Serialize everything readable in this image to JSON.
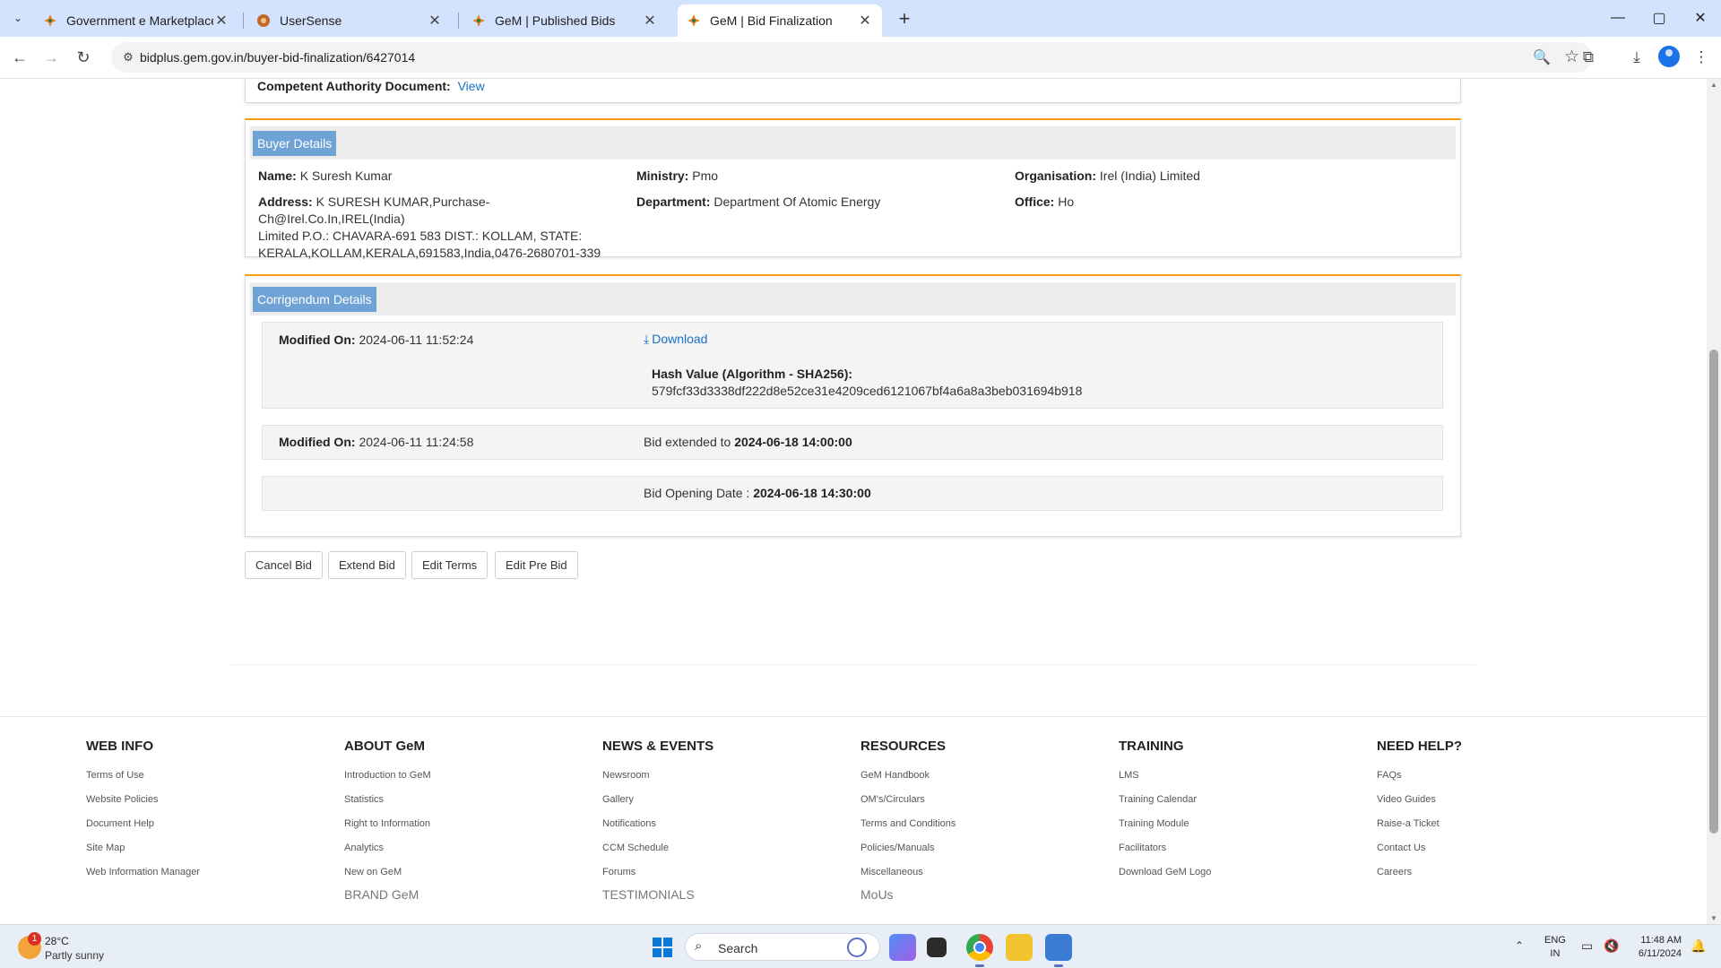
{
  "browser": {
    "tabs": [
      {
        "title": "Government e Marketplace (Ge",
        "close": "✕"
      },
      {
        "title": "UserSense",
        "close": "✕"
      },
      {
        "title": "GeM | Published Bids",
        "close": "✕"
      },
      {
        "title": "GeM | Bid Finalization",
        "close": "✕",
        "active": true
      }
    ],
    "url": "bidplus.gem.gov.in/buyer-bid-finalization/6427014",
    "window_controls": {
      "minimize": "—",
      "maximize": "▢",
      "close": "✕"
    },
    "new_tab": "+"
  },
  "page": {
    "competent_authority": {
      "label": "Competent Authority Document:",
      "link": "View"
    },
    "buyer_details": {
      "heading": "Buyer Details",
      "name_label": "Name:",
      "name": "K Suresh Kumar",
      "ministry_label": "Ministry:",
      "ministry": "Pmo",
      "organisation_label": "Organisation:",
      "organisation": "Irel (India) Limited",
      "address_label": "Address:",
      "address_line1": "K SURESH KUMAR,Purchase-Ch@Irel.Co.In,IREL(India)",
      "address_line2": "Limited P.O.: CHAVARA-691 583 DIST.: KOLLAM, STATE:",
      "address_line3": "KERALA,KOLLAM,KERALA,691583,India,0476-2680701-339",
      "department_label": "Department:",
      "department": "Department Of Atomic Energy",
      "office_label": "Office:",
      "office": "Ho"
    },
    "corrigendum": {
      "heading": "Corrigendum Details",
      "row1": {
        "modified_label": "Modified On:",
        "modified": "2024-06-11 11:52:24",
        "download": "Download",
        "hash_label": "Hash Value (Algorithm - SHA256):",
        "hash": "579fcf33d3338df222d8e52ce31e4209ced6121067bf4a6a8a3beb031694b918"
      },
      "row2": {
        "modified_label": "Modified On:",
        "modified": "2024-06-11 11:24:58",
        "extended_text": "Bid extended to",
        "extended_date": "2024-06-18 14:00:00"
      },
      "row3": {
        "opening_text": "Bid Opening Date :",
        "opening_date": "2024-06-18 14:30:00"
      }
    },
    "actions": [
      "Cancel Bid",
      "Extend Bid",
      "Edit Terms",
      "Edit Pre Bid"
    ]
  },
  "footer": {
    "columns": [
      {
        "heading": "WEB INFO",
        "links": [
          "Terms of Use",
          "Website Policies",
          "Document Help",
          "Site Map",
          "Web Information Manager"
        ],
        "sub": ""
      },
      {
        "heading": "ABOUT GeM",
        "links": [
          "Introduction to GeM",
          "Statistics",
          "Right to Information",
          "Analytics",
          "New on GeM"
        ],
        "sub": "BRAND GeM"
      },
      {
        "heading": "NEWS & EVENTS",
        "links": [
          "Newsroom",
          "Gallery",
          "Notifications",
          "CCM Schedule",
          "Forums"
        ],
        "sub": "TESTIMONIALS"
      },
      {
        "heading": "RESOURCES",
        "links": [
          "GeM Handbook",
          "OM's/Circulars",
          "Terms and Conditions",
          "Policies/Manuals",
          "Miscellaneous"
        ],
        "sub": "MoUs"
      },
      {
        "heading": "TRAINING",
        "links": [
          "LMS",
          "Training Calendar",
          "Training Module",
          "Facilitators",
          "Download GeM Logo"
        ],
        "sub": ""
      },
      {
        "heading": "NEED HELP?",
        "links": [
          "FAQs",
          "Video Guides",
          "Raise-a Ticket",
          "Contact Us",
          "Careers"
        ],
        "sub": ""
      }
    ]
  },
  "taskbar": {
    "weather_temp": "28°C",
    "weather_desc": "Partly sunny",
    "weather_badge": "1",
    "search_placeholder": "Search",
    "lang_line1": "ENG",
    "lang_line2": "IN",
    "time": "11:48 AM",
    "date": "6/11/2024"
  }
}
